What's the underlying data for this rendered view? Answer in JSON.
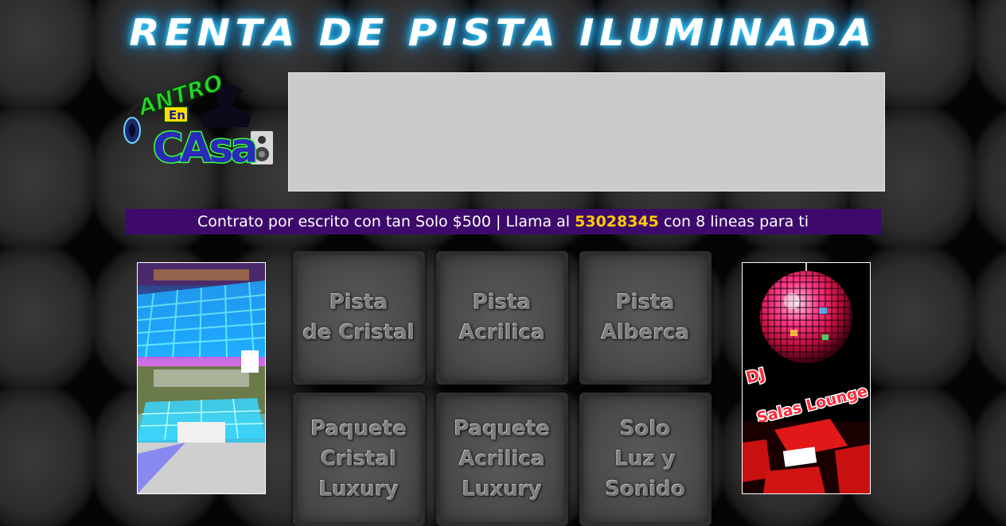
{
  "title": "RENTA DE PISTA ILUMINADA",
  "logo": {
    "icon": "antro-en-casa-logo",
    "text": "ANTRO En CASA"
  },
  "contract": {
    "prefix": "Contrato por escrito con tan Solo $500 | Llama al",
    "phone": "53028345",
    "suffix": "con 8 lineas para ti"
  },
  "right_ad": {
    "line1": "DJ",
    "line2": "Salas Lounge"
  },
  "menu": {
    "pista_cristal": "Pista\nde Cristal",
    "pista_acrilica": "Pista\nAcrilica",
    "pista_alberca": "Pista\nAlberca",
    "paquete_cristal": "Paquete\nCristal\nLuxury",
    "paquete_acrilica": "Paquete\nAcrilica\nLuxury",
    "solo_luz": "Solo\nLuz y\nSonido"
  },
  "colors": {
    "contract_bg": "#3d0a6b",
    "phone_highlight": "#ffcc00",
    "title_glow": "#1fb4ff"
  }
}
